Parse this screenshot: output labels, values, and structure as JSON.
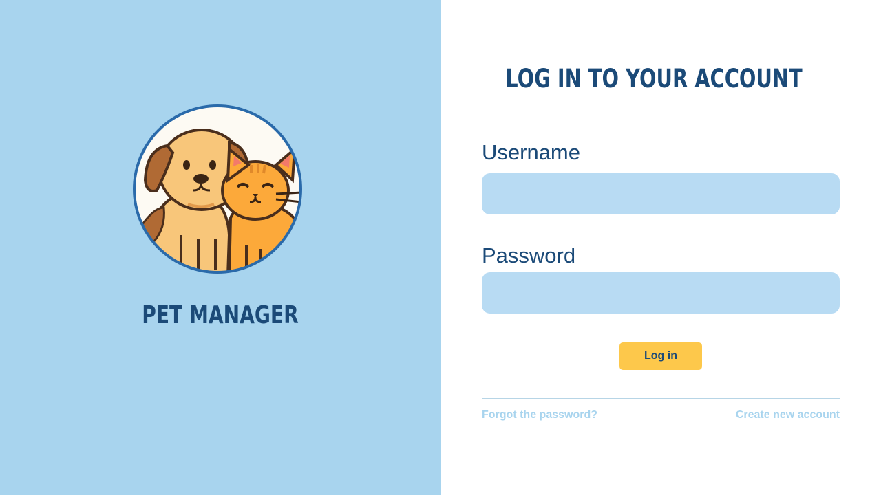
{
  "brand": {
    "name": "PET MANAGER",
    "logo_icon": "dog-and-cat-logo"
  },
  "login_form": {
    "title": "LOG IN TO YOUR ACCOUNT",
    "username_label": "Username",
    "username_value": "",
    "password_label": "Password",
    "password_value": "",
    "login_button_label": "Log in",
    "forgot_password_link": "Forgot the password?",
    "create_account_link": "Create new account"
  },
  "colors": {
    "left_panel_bg": "#a8d4ee",
    "primary_text": "#1b4a78",
    "input_bg": "#b8dbf3",
    "button_bg": "#fdc84b",
    "link_text": "#a8d4ee"
  }
}
